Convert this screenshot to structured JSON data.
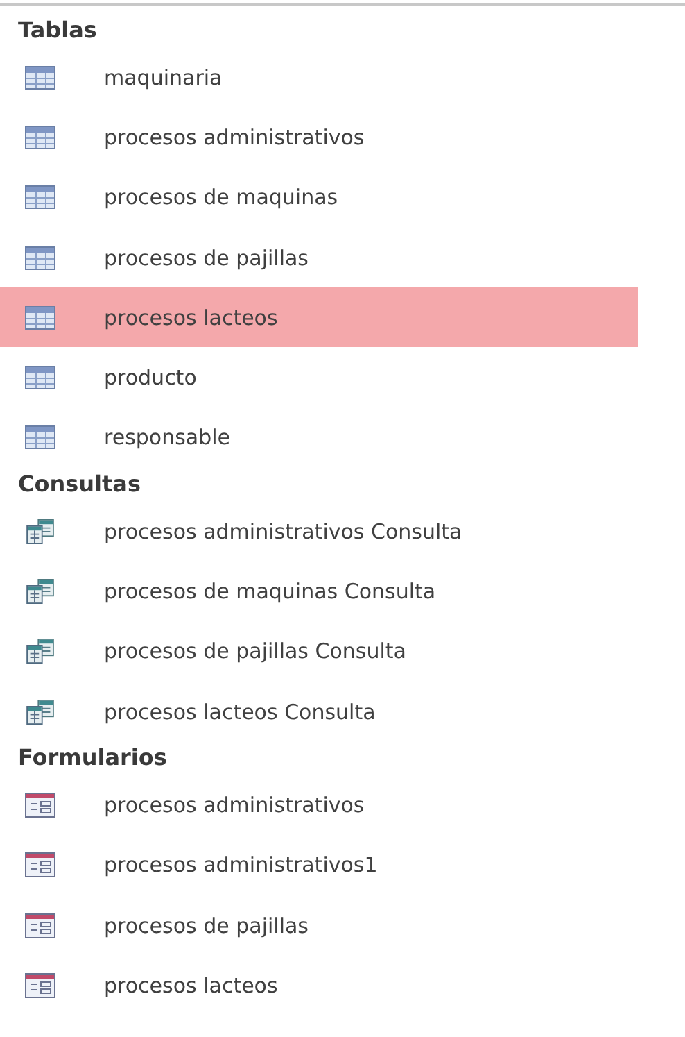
{
  "groups": [
    {
      "title": "Tablas",
      "kind": "table",
      "items": [
        {
          "label": "maquinaria",
          "selected": false
        },
        {
          "label": "procesos administrativos",
          "selected": false
        },
        {
          "label": "procesos de maquinas",
          "selected": false
        },
        {
          "label": "procesos de pajillas",
          "selected": false
        },
        {
          "label": "procesos lacteos",
          "selected": true
        },
        {
          "label": "producto",
          "selected": false
        },
        {
          "label": "responsable",
          "selected": false
        }
      ]
    },
    {
      "title": "Consultas",
      "kind": "query",
      "items": [
        {
          "label": "procesos administrativos Consulta",
          "selected": false
        },
        {
          "label": "procesos de maquinas Consulta",
          "selected": false
        },
        {
          "label": "procesos de pajillas Consulta",
          "selected": false
        },
        {
          "label": "procesos lacteos Consulta",
          "selected": false
        }
      ]
    },
    {
      "title": "Formularios",
      "kind": "form",
      "items": [
        {
          "label": "procesos administrativos",
          "selected": false
        },
        {
          "label": "procesos administrativos1",
          "selected": false
        },
        {
          "label": "procesos de pajillas",
          "selected": false
        },
        {
          "label": "procesos lacteos",
          "selected": false
        }
      ]
    }
  ]
}
